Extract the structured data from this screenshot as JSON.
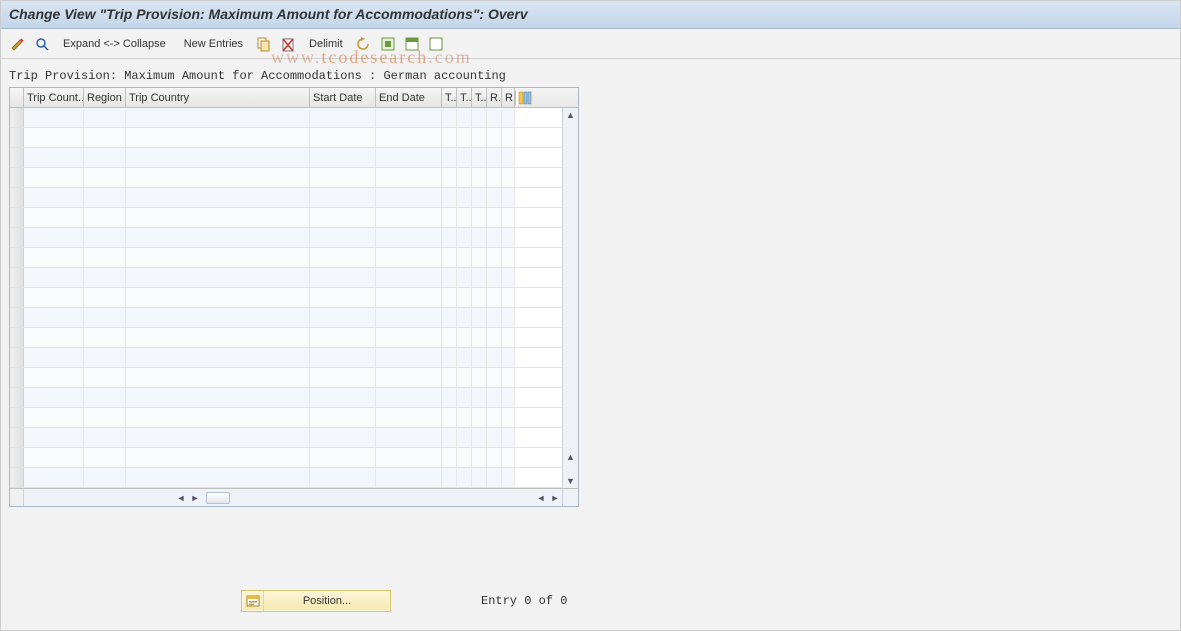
{
  "header": {
    "title": "Change View \"Trip Provision: Maximum Amount for Accommodations\": Overv"
  },
  "toolbar": {
    "expand_collapse_label": "Expand <-> Collapse",
    "new_entries_label": "New Entries",
    "delimit_label": "Delimit"
  },
  "subtitle": "Trip Provision: Maximum Amount for Accommodations : German accounting",
  "table": {
    "columns": [
      "Trip Count...",
      "Region",
      "Trip Country",
      "Start Date",
      "End Date",
      "T..",
      "T..",
      "T..",
      "R..",
      "R"
    ],
    "row_count": 19,
    "rows": []
  },
  "footer": {
    "position_label": "Position...",
    "entry_text": "Entry 0 of 0"
  },
  "watermark": {
    "part1": "www.",
    "part2": "tcodesearch",
    "part3": ".com"
  }
}
